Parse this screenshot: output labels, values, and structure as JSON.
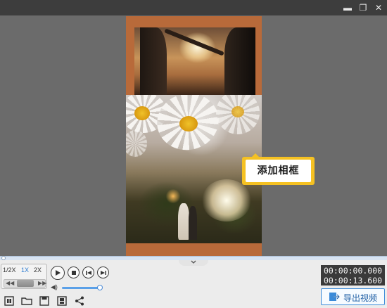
{
  "window": {
    "minimize_icon": "minimize-icon",
    "restore_icon": "restore-icon",
    "close_icon": "close-icon",
    "minimize_glyph": "▬",
    "restore_glyph": "❐",
    "close_glyph": "✕"
  },
  "preview": {
    "tooltip_text": "添加相框",
    "tooltip_color": "#f5c122",
    "frame_color": "#b86a3a"
  },
  "speed": {
    "options": [
      "1/2X",
      "1X",
      "2X"
    ],
    "selected": "1X",
    "rewind_glyph": "◀◀",
    "forward_glyph": "▶▶"
  },
  "playback": {
    "play_icon": "play-icon",
    "stop_icon": "stop-icon",
    "prev_frame_icon": "prev-frame-icon",
    "next_frame_icon": "next-frame-icon"
  },
  "volume": {
    "icon": "volume-icon",
    "glyph": "◀)",
    "level": 1.0
  },
  "timecode": {
    "current": "00:00:00.000",
    "total": "00:00:13.600"
  },
  "toolbar": {
    "icons": [
      "new-project-icon",
      "open-folder-icon",
      "save-icon",
      "save-as-icon",
      "share-icon"
    ],
    "export_label": "导出视频",
    "export_icon": "export-icon"
  },
  "colors": {
    "accent": "#3b8bd8",
    "titlebar": "#3d3d3d",
    "preview_bg": "#6b6b6b"
  }
}
